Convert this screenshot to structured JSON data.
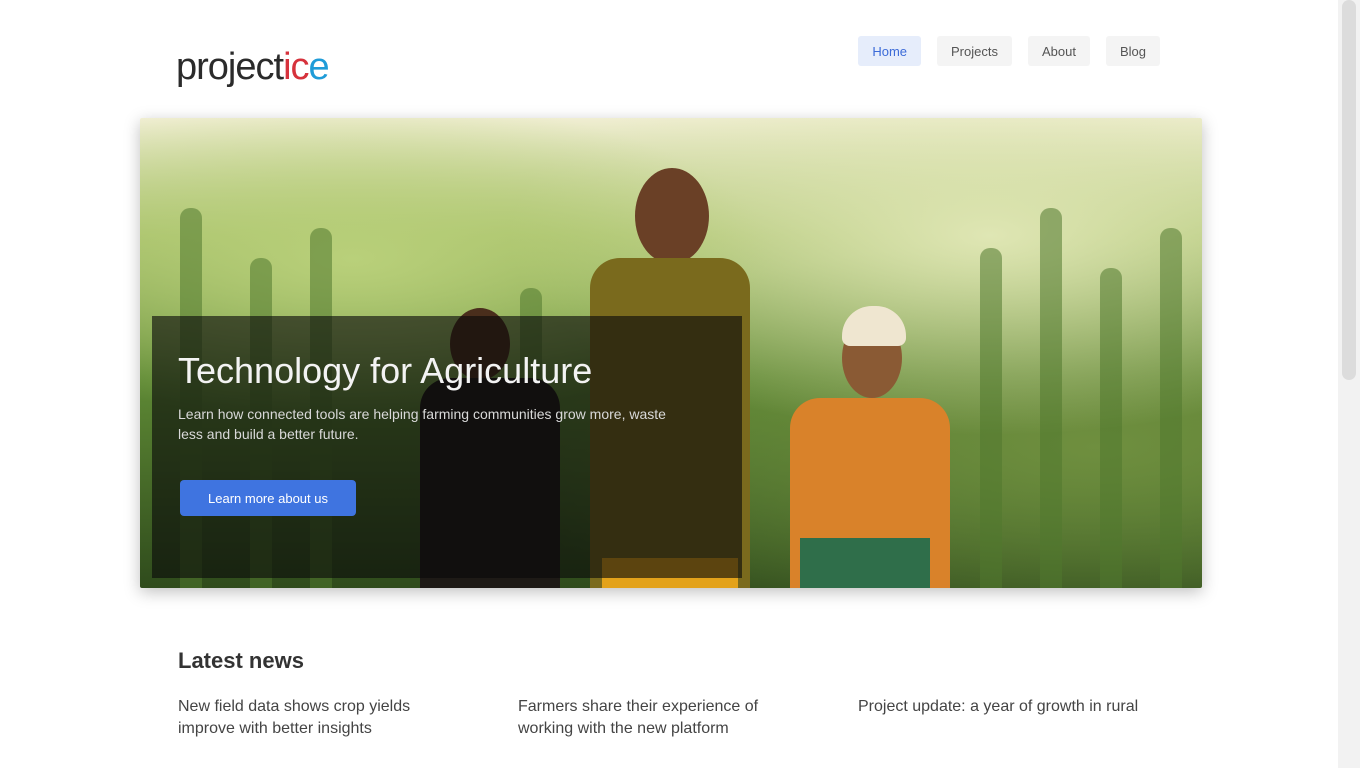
{
  "header": {
    "logo": {
      "part1": "pro",
      "part2": "ject",
      "part3": "ic",
      "part4": "e",
      "full": "projectice"
    },
    "nav": [
      {
        "label": "Home",
        "active": true
      },
      {
        "label": "Projects",
        "active": false
      },
      {
        "label": "About",
        "active": false
      },
      {
        "label": "Blog",
        "active": false
      }
    ]
  },
  "hero": {
    "title": "Technology for Agriculture",
    "description": "Learn how connected tools are helping farming communities grow more, waste less and build a better future.",
    "cta_label": "Learn more about us"
  },
  "news": {
    "heading": "Latest news",
    "items": [
      {
        "title": "New field data shows crop yields improve with better insights"
      },
      {
        "title": "Farmers share their experience of working with the new platform"
      },
      {
        "title": "Project update: a year of growth in rural"
      }
    ]
  },
  "colors": {
    "accent": "#3f74e0",
    "nav_active_bg": "#e6edfb"
  }
}
